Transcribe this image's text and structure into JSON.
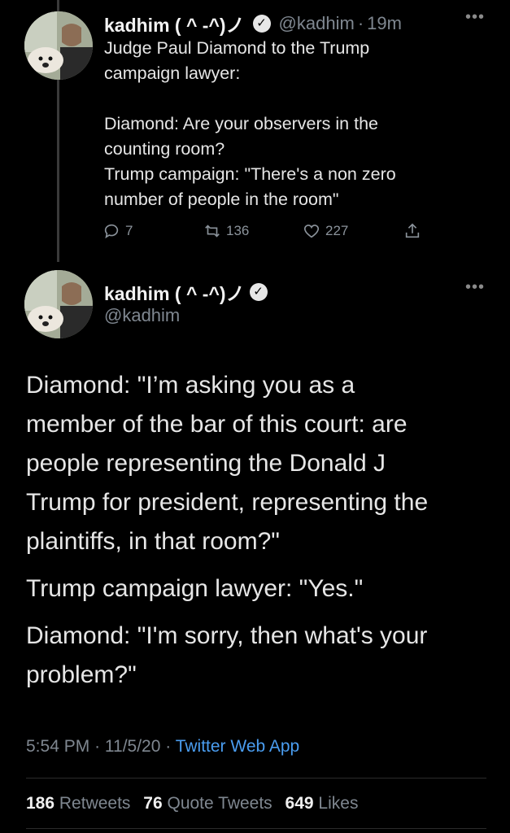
{
  "tweet1": {
    "display_name": "kadhim ( ^ -^)ノ",
    "handle": "@kadhim",
    "time": "19m",
    "lines": [
      "Judge Paul Diamond to the Trump",
      "campaign lawyer:",
      "",
      "Diamond: Are your observers in the",
      "counting room?",
      "Trump campaign: \"There's a non zero",
      "number of people in the room\""
    ],
    "replies": "7",
    "retweets": "136",
    "likes": "227"
  },
  "tweet2": {
    "display_name": "kadhim ( ^ -^)ノ",
    "handle": "@kadhim",
    "paragraphs": [
      [
        "Diamond: \"I’m asking you as a",
        "member of the bar of this court: are",
        "people representing the Donald J",
        "Trump for president, representing the",
        "plaintiffs, in that room?\""
      ],
      [
        "Trump campaign lawyer: \"Yes.\""
      ],
      [
        "Diamond: \"I'm sorry, then what's your",
        "problem?\""
      ]
    ],
    "time": "5:54 PM",
    "date": "11/5/20",
    "app": "Twitter Web App",
    "retweets_count": "186",
    "retweets_label": "Retweets",
    "quotes_count": "76",
    "quotes_label": "Quote Tweets",
    "likes_count": "649",
    "likes_label": "Likes"
  },
  "icons": {
    "verified": "verified-badge",
    "more": "more-options",
    "reply": "reply-icon",
    "retweet": "retweet-icon",
    "like": "heart-icon",
    "share": "share-icon"
  },
  "colors": {
    "background": "#000000",
    "accent": "#4a9df0",
    "muted": "#7f8790"
  }
}
